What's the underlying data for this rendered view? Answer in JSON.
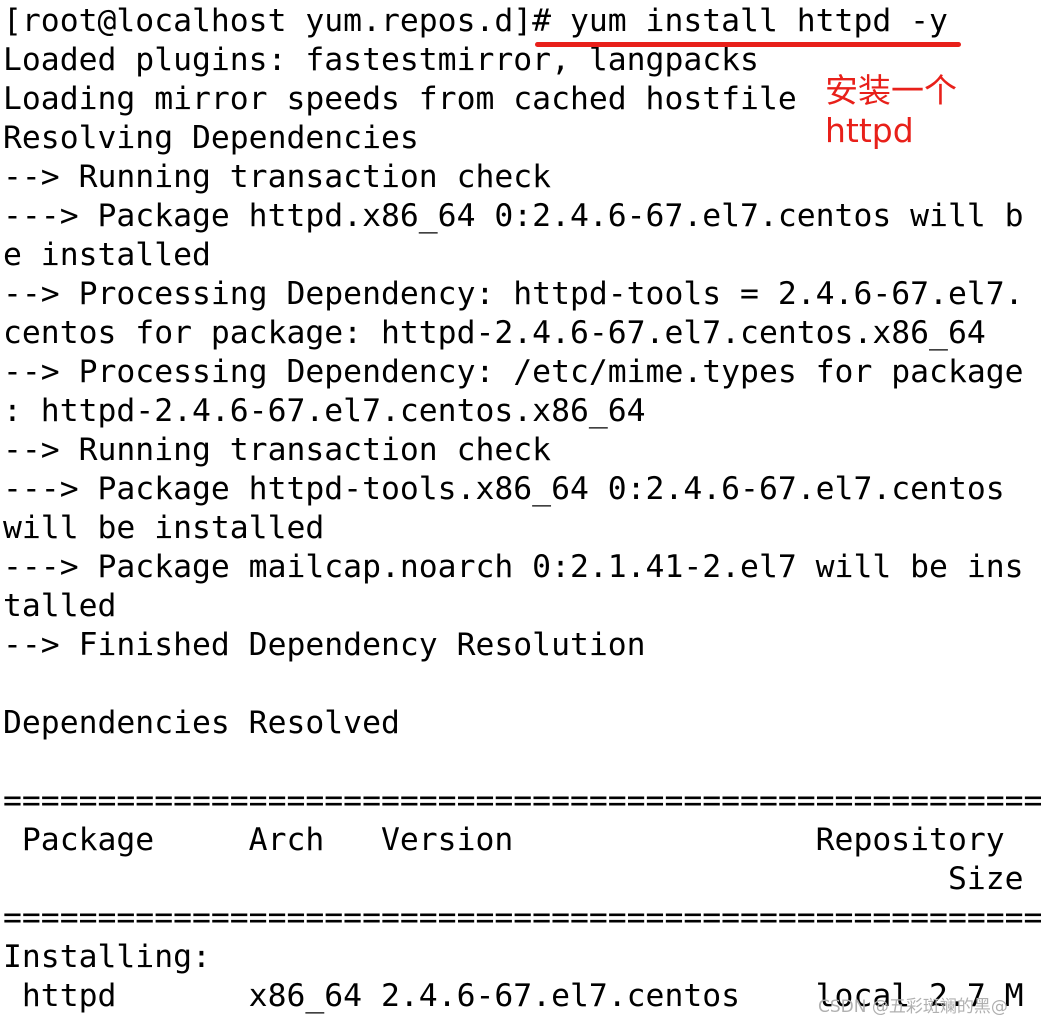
{
  "terminal": {
    "lines": [
      "[root@localhost yum.repos.d]# yum install httpd -y",
      "Loaded plugins: fastestmirror, langpacks",
      "Loading mirror speeds from cached hostfile",
      "Resolving Dependencies",
      "--> Running transaction check",
      "---> Package httpd.x86_64 0:2.4.6-67.el7.centos will b",
      "e installed",
      "--> Processing Dependency: httpd-tools = 2.4.6-67.el7.",
      "centos for package: httpd-2.4.6-67.el7.centos.x86_64",
      "--> Processing Dependency: /etc/mime.types for package",
      ": httpd-2.4.6-67.el7.centos.x86_64",
      "--> Running transaction check",
      "---> Package httpd-tools.x86_64 0:2.4.6-67.el7.centos",
      "will be installed",
      "---> Package mailcap.noarch 0:2.1.41-2.el7 will be ins",
      "talled",
      "--> Finished Dependency Resolution",
      "",
      "Dependencies Resolved",
      "",
      "=======================================================",
      " Package     Arch   Version                Repository",
      "                                                  Size",
      "=======================================================",
      "Installing:",
      " httpd       x86_64 2.4.6-67.el7.centos    local 2.7 M"
    ]
  },
  "annotation": {
    "line1": "安装一个",
    "line2": "httpd",
    "color": "#e8201a"
  },
  "watermark": "CSDN @五彩斑斓的黑@"
}
